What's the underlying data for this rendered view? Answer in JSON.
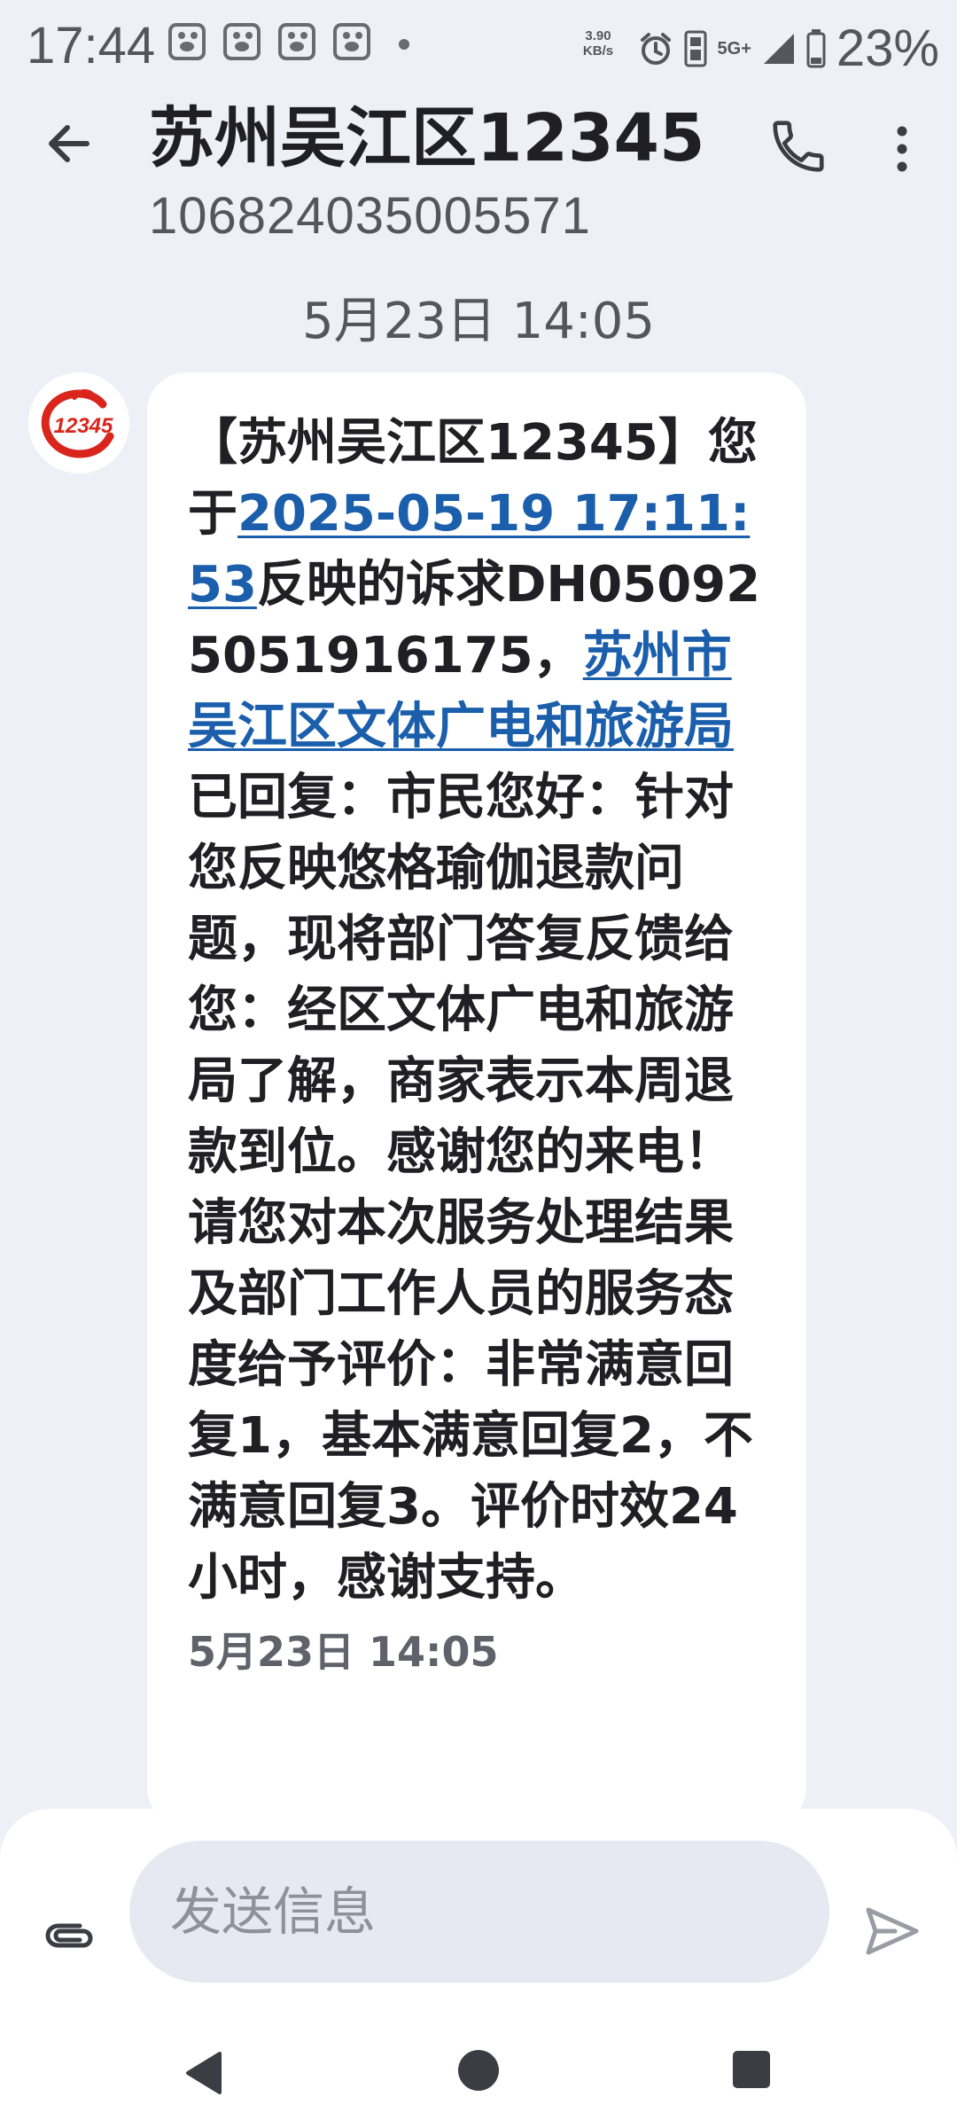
{
  "status_bar": {
    "time": "17:44",
    "net_speed_value": "3.90",
    "net_speed_unit": "KB/s",
    "network": "5G+",
    "battery": "23%"
  },
  "header": {
    "title": "苏州吴江区12345",
    "number": "106824035005571"
  },
  "date_separator": "5月23日 14:05",
  "message": {
    "seg1": "【苏州吴江区12345】您于",
    "link_time": "2025-05-19 17:11:53",
    "seg2": "反映的诉求DH050925051916175，",
    "link_dept": "苏州市吴江区文体广电和旅游局",
    "seg3": "已回复：市民您好：针对您反映悠格瑜伽退款问题，现将部门答复反馈给您：经区文体广电和旅游局了解，商家表示本周退款到位。感谢您的来电！ 请您对本次服务处理结果及部门工作人员的服务态度给予评价：非常满意回复1，基本满意回复2，不满意回复3。评价时效24小时，感谢支持。",
    "time": "5月23日 14:05"
  },
  "avatar_text": "12345",
  "compose": {
    "placeholder": "发送信息"
  },
  "colors": {
    "background": "#eff0f7",
    "link": "#1b5fac",
    "avatar_red": "#d9251c"
  }
}
